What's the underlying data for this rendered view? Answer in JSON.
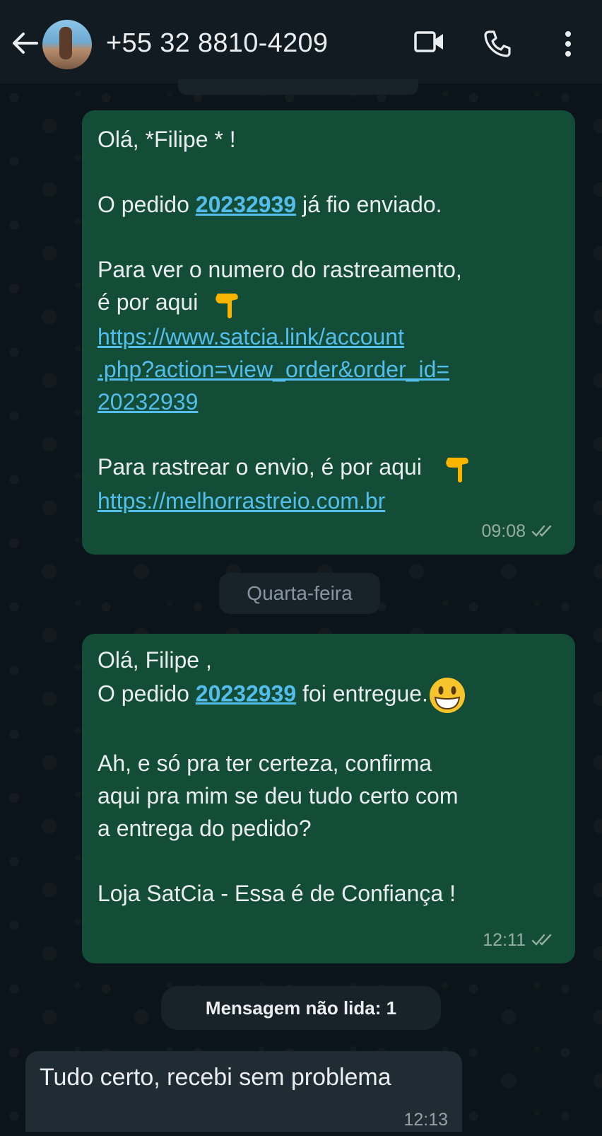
{
  "header": {
    "contact_name": "+55 32 8810-4209",
    "icons": [
      "back-arrow-icon",
      "video-call-icon",
      "voice-call-icon",
      "more-options-icon"
    ]
  },
  "messages": [
    {
      "direction": "outgoing",
      "greeting": "Olá, *Filipe * !",
      "order_prefix": "O pedido ",
      "order_number": "20232939",
      "order_suffix": " já fio enviado.",
      "tracking_line1": "Para ver o numero do rastreamento,",
      "tracking_line2": "é por aqui",
      "link1_line1": "https://www.satcia.link/account",
      "link1_line2": ".php?action=view_order&order_id=",
      "link1_line3": "20232939",
      "ship_line": "Para rastrear o envio, é por aqui",
      "link2": "https://melhorrastreio.com.br",
      "time": "09:08",
      "status": "read"
    },
    {
      "direction": "outgoing",
      "greeting": "Olá, Filipe ,",
      "order_prefix": "O pedido ",
      "order_number": "20232939",
      "order_suffix": " foi entregue.",
      "line3": "Ah, e só pra ter certeza, confirma",
      "line4": "aqui pra mim se deu tudo certo com",
      "line5": "a entrega do pedido?",
      "signature": "Loja SatCia - Essa é de Confiança !",
      "time": "12:11",
      "status": "read"
    },
    {
      "direction": "incoming",
      "text": "Tudo certo, recebi sem problema",
      "time": "12:13"
    }
  ],
  "date_divider": "Quarta-feira",
  "unread_divider": "Mensagem não lida: 1",
  "colors": {
    "header_bg": "#111b21",
    "chat_bg": "#0b141a",
    "outgoing_bubble": "#144d37",
    "incoming_bubble": "#202c33",
    "link": "#53bdeb"
  }
}
